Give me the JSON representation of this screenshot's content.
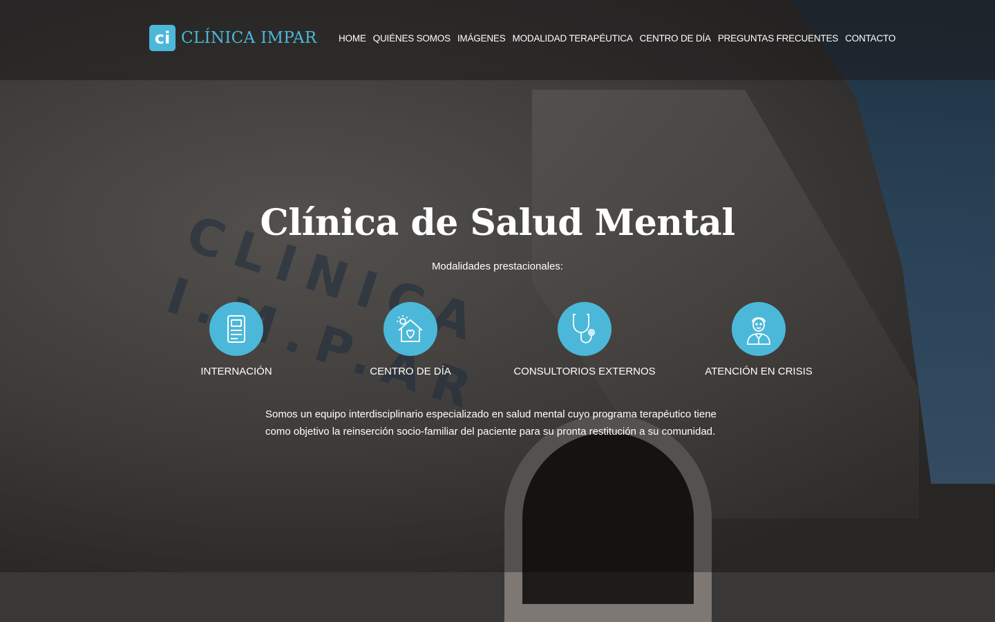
{
  "brand": {
    "logo_mark": "ci",
    "name": "CLÍNICA IMPAR",
    "accent": "#4cb8d9"
  },
  "nav": {
    "items": [
      {
        "label": "HOME"
      },
      {
        "label": "QUIÉNES SOMOS"
      },
      {
        "label": "IMÁGENES"
      },
      {
        "label": "MODALIDAD TERAPÉUTICA"
      },
      {
        "label": "CENTRO DE DÍA"
      },
      {
        "label": "PREGUNTAS FRECUENTES"
      },
      {
        "label": "CONTACTO"
      }
    ]
  },
  "hero": {
    "title": "Clínica de Salud Mental",
    "subtitle": "Modalidades prestacionales:",
    "services": [
      {
        "label": "INTERNACIÓN",
        "icon": "document-icon"
      },
      {
        "label": "CENTRO DE DÍA",
        "icon": "home-heart-icon"
      },
      {
        "label": "CONSULTORIOS EXTERNOS",
        "icon": "stethoscope-icon"
      },
      {
        "label": "ATENCIÓN EN CRISIS",
        "icon": "doctor-icon"
      }
    ],
    "description": "Somos un equipo interdisciplinario especializado en salud mental cuyo programa terapéutico tiene como objetivo la reinserción socio-familiar del paciente para su pronta restitución a su comunidad."
  },
  "background": {
    "sign_text": "CLINICA I.M.P.AR"
  }
}
